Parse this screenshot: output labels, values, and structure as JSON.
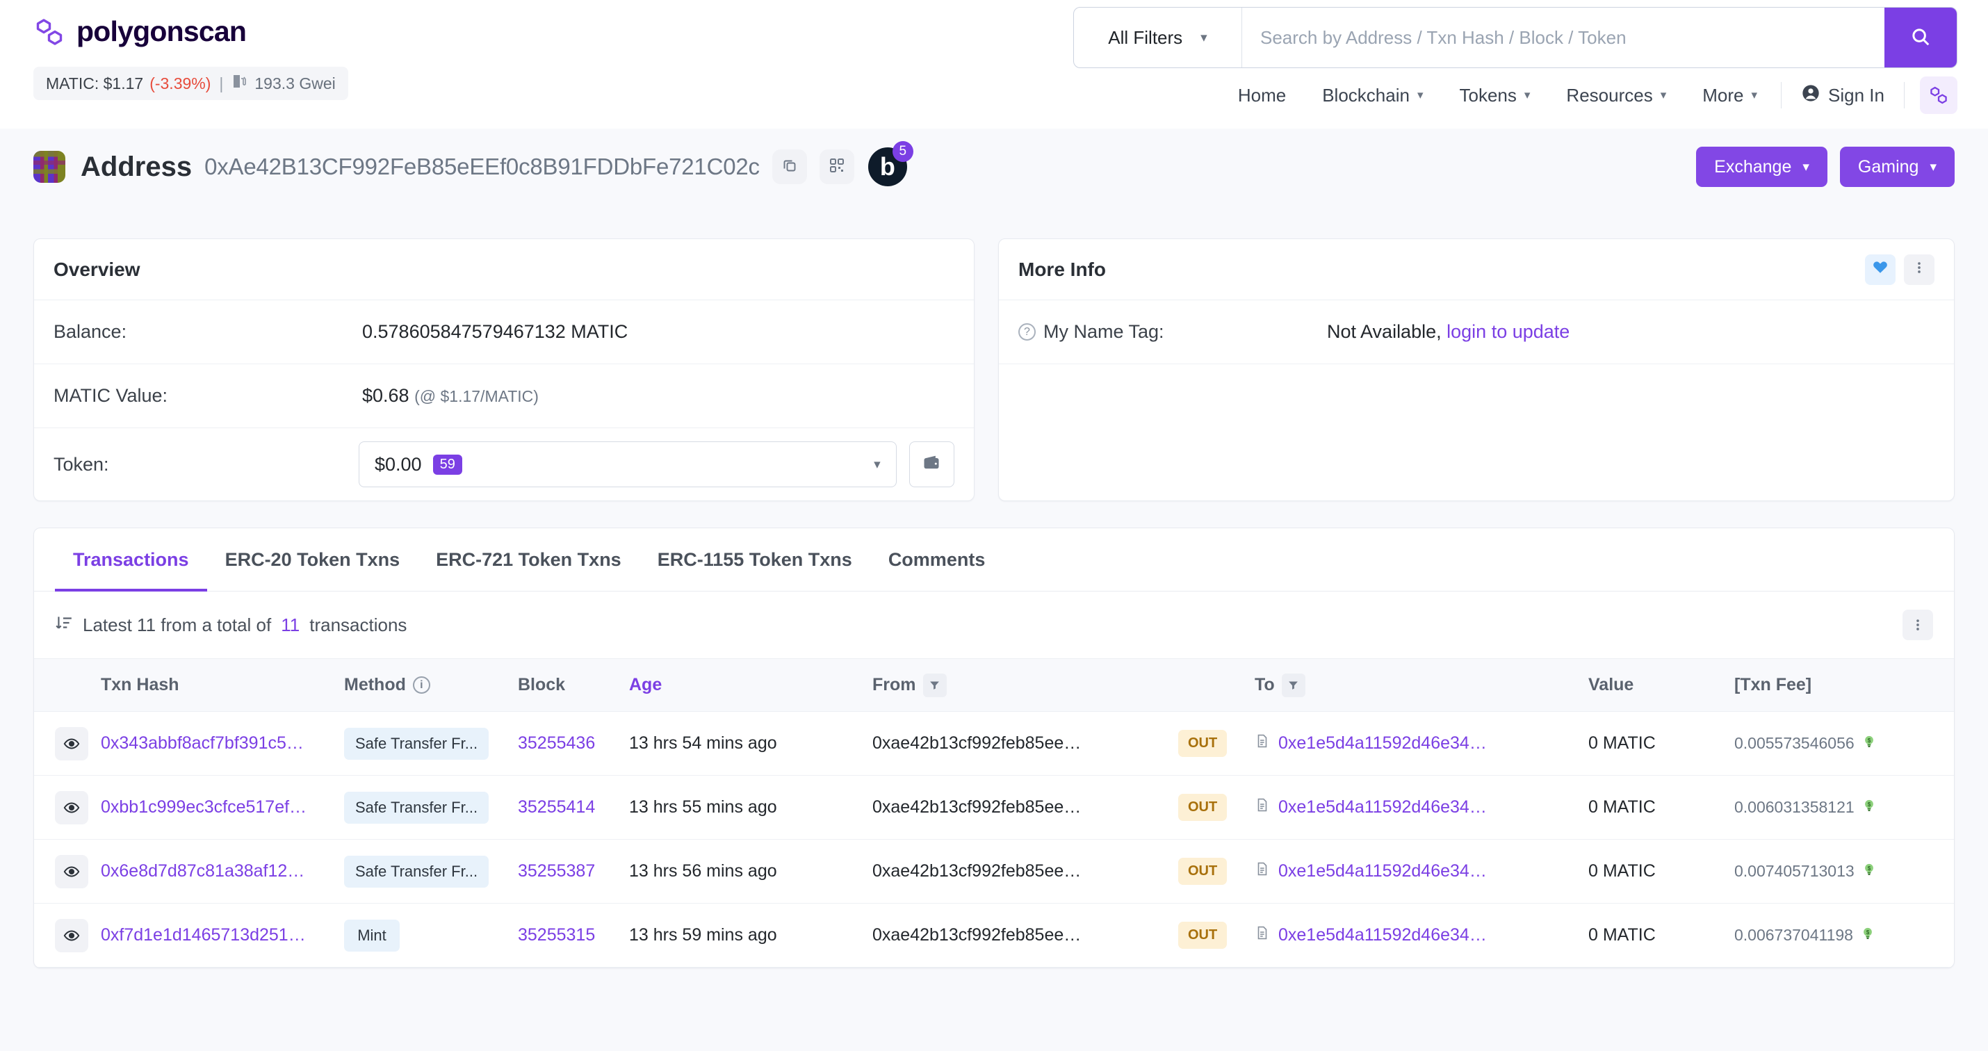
{
  "brand": {
    "name": "polygonscan",
    "logo_icon": "polygon-logo-icon"
  },
  "ticker": {
    "price_label": "MATIC: $1.17",
    "change": "(-3.39%)",
    "separator": "|",
    "gas_icon": "gas-pump-icon",
    "gas": "193.3 Gwei"
  },
  "search": {
    "filter_label": "All Filters",
    "placeholder": "Search by Address / Txn Hash / Block / Token",
    "value": "",
    "search_icon": "search-icon",
    "chevron_icon": "chevron-down-icon"
  },
  "nav": {
    "items": [
      {
        "label": "Home",
        "caret": false
      },
      {
        "label": "Blockchain",
        "caret": true
      },
      {
        "label": "Tokens",
        "caret": true
      },
      {
        "label": "Resources",
        "caret": true
      },
      {
        "label": "More",
        "caret": true
      }
    ],
    "sign_in": "Sign In",
    "sign_in_icon": "user-circle-icon",
    "network_icon": "polygon-network-icon"
  },
  "address_header": {
    "title": "Address",
    "hash": "0xAe42B13CF992FeB85eEEf0c8B91FDDbFe721C02c",
    "copy_icon": "copy-icon",
    "qr_icon": "qr-code-icon",
    "blockscan_letter": "b",
    "blockscan_count": "5",
    "actions": [
      {
        "label": "Exchange",
        "caret": "chevron-down-icon"
      },
      {
        "label": "Gaming",
        "caret": "chevron-down-icon"
      }
    ]
  },
  "overview": {
    "title": "Overview",
    "balance_label": "Balance:",
    "balance_value": "0.578605847579467132 MATIC",
    "matic_value_label": "MATIC Value:",
    "matic_value": "$0.68",
    "matic_rate": "(@ $1.17/MATIC)",
    "token_label": "Token:",
    "token_amount": "$0.00",
    "token_count": "59",
    "token_chevron_icon": "chevron-down-icon",
    "wallet_icon": "wallet-icon"
  },
  "more_info": {
    "title": "More Info",
    "favorite_icon": "heart-icon",
    "menu_icon": "dots-vertical-icon",
    "name_tag_label": "My Name Tag:",
    "name_tag_help_icon": "question-circle-icon",
    "name_tag_value": "Not Available,",
    "name_tag_link": "login to update"
  },
  "tabs": [
    {
      "label": "Transactions",
      "active": true
    },
    {
      "label": "ERC-20 Token Txns",
      "active": false
    },
    {
      "label": "ERC-721 Token Txns",
      "active": false
    },
    {
      "label": "ERC-1155 Token Txns",
      "active": false
    },
    {
      "label": "Comments",
      "active": false
    }
  ],
  "summary": {
    "sort_icon": "sort-descending-icon",
    "prefix": "Latest 11 from a total of",
    "total": "11",
    "suffix": "transactions",
    "menu_icon": "dots-vertical-icon"
  },
  "table": {
    "headers": {
      "txn_hash": "Txn Hash",
      "method": "Method",
      "method_info_icon": "info-icon",
      "block": "Block",
      "age": "Age",
      "from": "From",
      "from_filter_icon": "filter-icon",
      "to": "To",
      "to_filter_icon": "filter-icon",
      "value": "Value",
      "txn_fee": "[Txn Fee]"
    },
    "rows": [
      {
        "eye_icon": "eye-icon",
        "hash": "0x343abbf8acf7bf391c5…",
        "method": "Safe Transfer Fr...",
        "block": "35255436",
        "age": "13 hrs 54 mins ago",
        "from": "0xae42b13cf992feb85ee…",
        "direction": "OUT",
        "to_icon": "contract-icon",
        "to": "0xe1e5d4a11592d46e34…",
        "value": "0 MATIC",
        "fee": "0.005573546056",
        "fee_icon": "gas-saver-icon"
      },
      {
        "eye_icon": "eye-icon",
        "hash": "0xbb1c999ec3cfce517ef…",
        "method": "Safe Transfer Fr...",
        "block": "35255414",
        "age": "13 hrs 55 mins ago",
        "from": "0xae42b13cf992feb85ee…",
        "direction": "OUT",
        "to_icon": "contract-icon",
        "to": "0xe1e5d4a11592d46e34…",
        "value": "0 MATIC",
        "fee": "0.006031358121",
        "fee_icon": "gas-saver-icon"
      },
      {
        "eye_icon": "eye-icon",
        "hash": "0x6e8d7d87c81a38af12…",
        "method": "Safe Transfer Fr...",
        "block": "35255387",
        "age": "13 hrs 56 mins ago",
        "from": "0xae42b13cf992feb85ee…",
        "direction": "OUT",
        "to_icon": "contract-icon",
        "to": "0xe1e5d4a11592d46e34…",
        "value": "0 MATIC",
        "fee": "0.007405713013",
        "fee_icon": "gas-saver-icon"
      },
      {
        "eye_icon": "eye-icon",
        "hash": "0xf7d1e1d1465713d251…",
        "method": "Mint",
        "block": "35255315",
        "age": "13 hrs 59 mins ago",
        "from": "0xae42b13cf992feb85ee…",
        "direction": "OUT",
        "to_icon": "contract-icon",
        "to": "0xe1e5d4a11592d46e34…",
        "value": "0 MATIC",
        "fee": "0.006737041198",
        "fee_icon": "gas-saver-icon"
      }
    ]
  },
  "colors": {
    "accent_purple": "#7b3fe4",
    "button_purple": "#8247e5",
    "down_red": "#e74c3c",
    "out_amber_bg": "#fdf0d5",
    "out_amber_text": "#a8700b",
    "method_blue_bg": "#e8f2fb"
  }
}
